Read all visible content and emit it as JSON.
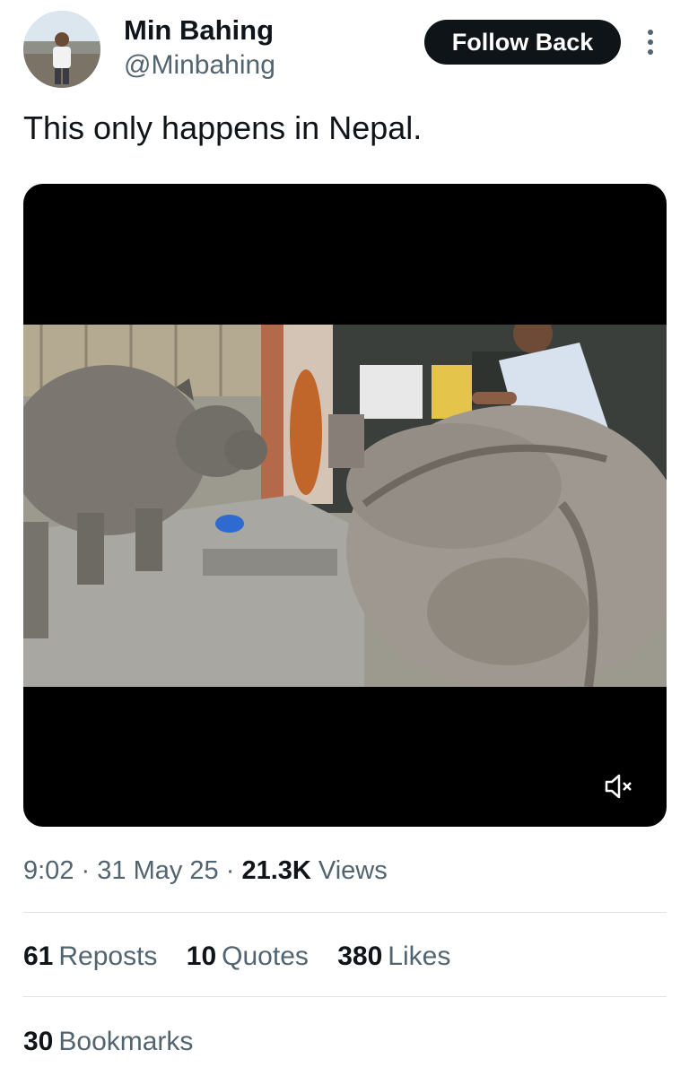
{
  "author": {
    "name": "Min Bahing",
    "handle": "@Minbahing",
    "avatar_icon": "profile-photo"
  },
  "follow_button_label": "Follow Back",
  "more_icon": "more-vertical-icon",
  "tweet": {
    "text": "This only happens in Nepal."
  },
  "media": {
    "type": "video",
    "description_icon": "rhinoceros-video-frame",
    "mute_icon": "volume-muted-icon"
  },
  "meta": {
    "time": "9:02",
    "separator": "·",
    "date": "31 May 25",
    "views_count": "21.3K",
    "views_label": "Views"
  },
  "stats": {
    "reposts": {
      "count": "61",
      "label": "Reposts"
    },
    "quotes": {
      "count": "10",
      "label": "Quotes"
    },
    "likes": {
      "count": "380",
      "label": "Likes"
    },
    "bookmarks": {
      "count": "30",
      "label": "Bookmarks"
    }
  },
  "colors": {
    "text": "#0f1419",
    "secondary": "#536471",
    "button_bg": "#0f1419",
    "divider": "#dfe3e7"
  }
}
